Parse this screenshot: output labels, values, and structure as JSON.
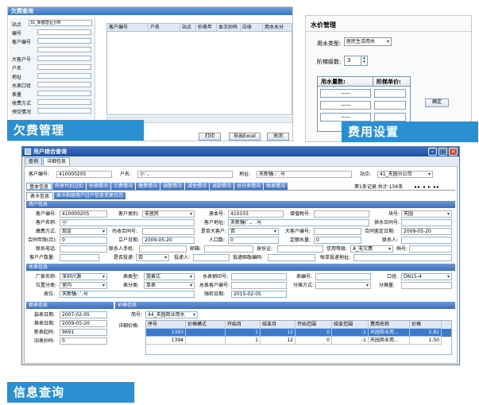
{
  "panel_arrears": {
    "window_title": "欠费查询",
    "station_label": "站点",
    "station_value": "31_新都营业分所",
    "filter_labels": [
      "编号",
      "客户编号",
      "",
      "大客户号",
      "户名",
      "地址",
      "水表口径",
      "表量",
      "收费方式",
      "预交情况"
    ],
    "grid_columns": [
      "客户编号",
      "户名",
      "站点",
      "抄表年",
      "本次抄码",
      "应收",
      "用水水分"
    ],
    "right_header": "用水水分",
    "bottom_buttons": [
      "打印",
      "导出Excel",
      "关闭"
    ],
    "banner": "欠费管理"
  },
  "panel_fee": {
    "title": "水价管理",
    "water_type_label": "用水类型:",
    "water_type_value": "居民生活用水",
    "tier_label": "阶梯级数:",
    "tier_value": "3",
    "table_header_qty": "用水量数:",
    "table_header_price": "阶梯单价:",
    "row_value": "——",
    "confirm_button": "确定",
    "banner": "费用设置"
  },
  "panel_info": {
    "window_title": "用户综合查询",
    "top_tabs": [
      "查询",
      "详细信息"
    ],
    "customer_no_label": "客户编号:",
    "customer_no": "410000205",
    "name_label": "户名:",
    "name_value": "小`、",
    "address_label": "地址:",
    "address_value": "天新騒::`.号",
    "station_label": "站点:",
    "station_value": "41_天园分公司",
    "detail_tabs": [
      "基本信息",
      "托收代扣过扣",
      "抄表情况",
      "欠费情况",
      "缴费情况",
      "调整情况",
      "减免情况",
      "退款情况",
      "总分表情况",
      "换表情况"
    ],
    "record_info": "第1条记录 共计:156条",
    "sub_tabs": [
      "表卡信息",
      "表卡和原用户过户信息变更日志"
    ],
    "user_section": "用户信息",
    "user_fields": {
      "cust_no_l": "客户编号:",
      "cust_no": "410000205",
      "cust_type_l": "客户类别:",
      "cust_type": "非居民",
      "book_l": "册本号:",
      "book": "410103",
      "vat_l": "增值税号:",
      "vat": "",
      "block_l": "块号:",
      "block": "天园",
      "cname_l": "客户名称:",
      "cname": "小`",
      "caddr_l": "客户地址:",
      "caddr": "天新騒(`.、.号",
      "supply_l": "供水合同号:",
      "supply": "",
      "pay_l": "缴费方式:",
      "pay": "现金",
      "trust_l": "托收合同号:",
      "trust": "",
      "big_l": "是否大客户:",
      "big": "否",
      "bigno_l": "大客户编号:",
      "bigno": "",
      "sign_l": "合同鉴定日期:",
      "sign": "2009-05-20",
      "cyear_l": "合同年限(月):",
      "cyear": "0",
      "open_l": "立户日期:",
      "open": "2009-05-20",
      "pop_l": "人口数:",
      "pop": "0",
      "fix_l": "定额水量:",
      "fix": "0",
      "contact_l": "联系人:",
      "contact": "",
      "phone_l": "联系电话:",
      "phone": "",
      "mobile_l": "联系人手机:",
      "mobile": "",
      "email_l": "邮箱:",
      "email": "",
      "id_l": "身份证:",
      "id": "",
      "credit_l": "信用等级:",
      "credit": "A_无欠费",
      "file_l": "档号:",
      "file": "",
      "cnum_l": "客户户数量:",
      "cnum": "",
      "dun_l": "是否投递:",
      "dun": "否",
      "post_l": "投递人:",
      "post": "",
      "pcode_l": "投递邮政编码:",
      "pcode": "",
      "bill_l": "帐单投递地址:",
      "bill": ""
    },
    "meter_section": "水表信息",
    "meter_fields": {
      "maker_l": "厂家名称:",
      "maker": "深圳兴源",
      "mtype_l": "表类型:",
      "mtype": "旋翼式",
      "seal_l": "水表钢印号:",
      "seal": "",
      "mno_l": "表编号:",
      "mno": "",
      "cal_l": "口径:",
      "cal": "DN15-4",
      "pos_l": "位置分类:",
      "pos": "室内",
      "cls_l": "表分类:",
      "cls": "单表",
      "total_l": "总表客户编号:",
      "total": "",
      "split_l": "分摊方式:",
      "split": "",
      "amt_l": "分摊量:",
      "amt": "",
      "loc_l": "表位:",
      "loc": "天新騒::`.号",
      "check_l": "强检日期:",
      "check": "2015-02-05"
    },
    "change_section": "换表信息",
    "change_fields": {
      "install_l": "装表日期:",
      "install": "2007-02-05",
      "chg_l": "换表日期:",
      "chg": "2009-05-20",
      "newcode_l": "新表起码:",
      "newcode": "9691",
      "oldcode_l": "旧表抄码:",
      "oldcode": "0"
    },
    "price_section": "价格信息",
    "price_fields": {
      "short_l": "简号:",
      "short": "44_天园商业用水",
      "detail_l": "详细价格:"
    },
    "price_columns": [
      "序号",
      "价格模式",
      "开始月",
      "结束月",
      "开始范围",
      "结束范围",
      "费用名称",
      "价格"
    ],
    "price_rows": [
      [
        "1393",
        "",
        "1",
        "12",
        "0",
        "-1",
        "天园商业用...",
        "2.82"
      ],
      [
        "1394",
        "",
        "1",
        "12",
        "0",
        "-1",
        "天园商业用...",
        "1.50"
      ]
    ],
    "banner": "信息查询"
  }
}
